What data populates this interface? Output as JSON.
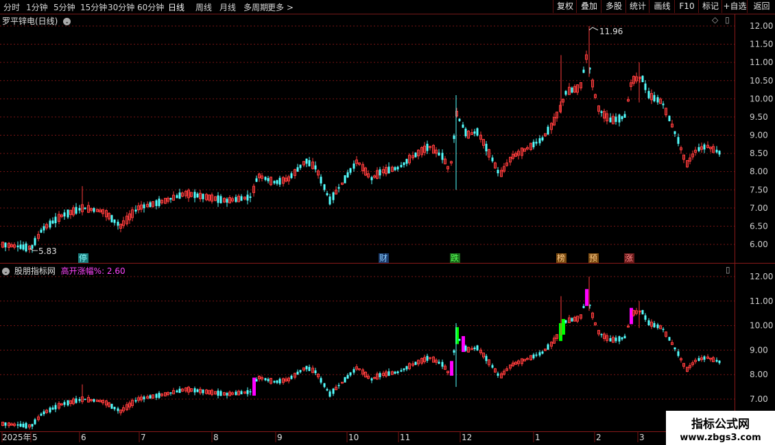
{
  "toolbar": {
    "period_tabs": [
      "分时",
      "1分钟",
      "5分钟",
      "15分钟",
      "30分钟",
      "60分钟",
      "日线",
      "周线",
      "月线",
      "多周期",
      "更多 >"
    ],
    "active_tab": "日线",
    "right_buttons": [
      "复权",
      "叠加",
      "多股",
      "统计",
      "画线",
      "F10",
      "标记",
      "+自选",
      "返回"
    ]
  },
  "main_panel": {
    "title": "罗平锌电(日线)",
    "max_label": "11.96",
    "min_label": "5.83",
    "y_ticks": [
      "12.00",
      "11.50",
      "11.00",
      "10.50",
      "10.00",
      "9.50",
      "9.00",
      "8.50",
      "8.00",
      "7.50",
      "7.00",
      "6.50",
      "6.00"
    ],
    "event_markers": [
      "停",
      "财",
      "跌",
      "榜",
      "预",
      "涨"
    ]
  },
  "indicator_panel": {
    "title": "股朋指标网",
    "indicator_label": "高开涨幅%: 2.60",
    "y_ticks": [
      "12.00",
      "11.00",
      "10.00",
      "9.00",
      "8.00",
      "7.00"
    ]
  },
  "date_axis": {
    "labels": [
      "2025年",
      "5",
      "6",
      "7",
      "8",
      "9",
      "10",
      "11",
      "12",
      "1",
      "2",
      "3"
    ]
  },
  "watermark": {
    "line1": "指标公式网",
    "line2": "www.zbgs3.com"
  },
  "colors": {
    "up": "#ff3c3c",
    "down": "#54ffff",
    "grid": "#7a1414",
    "highlight_magenta": "#ff00ff",
    "highlight_green": "#00ff00"
  },
  "chart_data": {
    "type": "candlestick",
    "x_range": [
      "2025-04",
      "2026-03"
    ],
    "ylim_main": [
      5.8,
      12.2
    ],
    "ylim_indicator": [
      6.8,
      12.2
    ],
    "close_approx": [
      6.0,
      6.1,
      6.3,
      6.6,
      6.9,
      7.1,
      7.0,
      6.7,
      7.0,
      7.3,
      7.4,
      7.6,
      7.4,
      7.3,
      7.2,
      7.3,
      7.9,
      7.7,
      7.6,
      7.7,
      8.3,
      7.8,
      7.3,
      7.9,
      7.5,
      8.2,
      8.0,
      7.8,
      8.3,
      8.6,
      8.3,
      7.9,
      8.5,
      8.7,
      10.0,
      8.8,
      9.3,
      8.0,
      8.4,
      8.6,
      9.2,
      10.5,
      10.0,
      11.3,
      9.8,
      9.4,
      9.6,
      10.5,
      10.1,
      9.0,
      8.6,
      8.3
    ]
  }
}
